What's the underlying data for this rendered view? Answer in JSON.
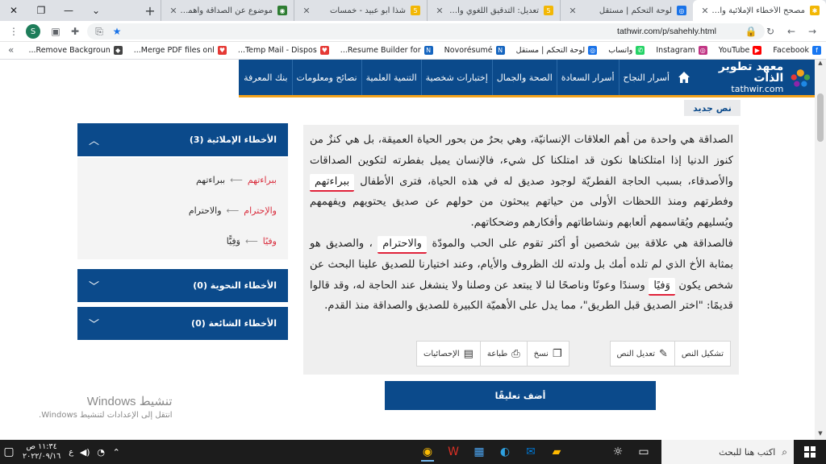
{
  "browser": {
    "tabs": [
      {
        "title": "مصحح الأخطاء الإملائية والنحوية",
        "favicon_color": "#f2b705",
        "active": true
      },
      {
        "title": "لوحة التحكم | مستقل",
        "favicon_color": "#1a73e8",
        "active": false
      },
      {
        "title": "تعديل: التدقيق اللغوي والإملائي",
        "favicon_color": "#f2b705",
        "active": false
      },
      {
        "title": "شذا أبو عبيد - خمسات",
        "favicon_color": "#f2b705",
        "active": false
      },
      {
        "title": "موضوع عن الصداقة وأهميتها",
        "favicon_color": "#2e7d32",
        "active": false
      }
    ],
    "url": "tathwir.com/p/sahehly.html",
    "profile_initial": "S",
    "bookmarks": [
      {
        "label": "Facebook",
        "icon": "facebook-icon",
        "color": "#1877f2"
      },
      {
        "label": "YouTube",
        "icon": "youtube-icon",
        "color": "#ff0000"
      },
      {
        "label": "Instagram",
        "icon": "instagram-icon",
        "color": "#c13584"
      },
      {
        "label": "واتساب",
        "icon": "whatsapp-icon",
        "color": "#25d366"
      },
      {
        "label": "لوحة التحكم | مستقل",
        "icon": "mostaql-icon",
        "color": "#1a73e8"
      },
      {
        "label": "Novorésumé",
        "icon": "novoresume-icon",
        "color": "#1565c0"
      },
      {
        "label": "Resume Builder for...",
        "icon": "resume-icon",
        "color": "#1565c0"
      },
      {
        "label": "Temp Mail - Dispos...",
        "icon": "tempmail-icon",
        "color": "#e53935"
      },
      {
        "label": "Merge PDF files onl...",
        "icon": "pdf-icon",
        "color": "#e53935"
      },
      {
        "label": "Remove Backgroun...",
        "icon": "removebg-icon",
        "color": "#444444"
      }
    ]
  },
  "site": {
    "logo_title": "معهد تطوير الذات",
    "logo_url": "tathwir.com",
    "nav": [
      "أسرار النجاح",
      "أسرار السعادة",
      "الصحة والجمال",
      "إختبارات شخصية",
      "التنمية العلمية",
      "نصائح ومعلومات",
      "بنك المعرفة"
    ]
  },
  "editor": {
    "label": "نص جديد",
    "p1_a": "الصداقة هي واحدة من أهم العلاقات الإنسانيّة، وهي بحرٌ من بحور الحياة العميقة، بل هي كنزٌ من كنوز الدنيا إذا امتلكناها نكون قد امتلكنا كل شيء، فالإنسان يميل بفطرته لتكوين الصداقات والأصدقاء، بسبب الحاجة الفطريّة لوجود صديق له في هذه الحياة، فترى الأطفال",
    "err1": "ببراءتهم",
    "p1_b": "وفطرتهم ومنذ اللحظات الأولى من حياتهم يبحثون من حولهم عن صديق يحتويهم ويفهمهم ويُسليهم ويُقاسمهم ألعابهم ونشاطاتهم وأفكارهم وضحكاتهم.",
    "p2_a": "فالصداقة هي علاقة بين شخصين أو أكثر تقوم على الحب والمودّة",
    "err2": "والاحترام",
    "p2_b": "، والصديق هو بمثابة الأخ الذي لم تلده أمك بل ولدته لك الظروف والأيام، وعند اختيارنا للصديق علينا البحث عن شخص يكون",
    "err3": "وَفيًا",
    "p2_c": "وسندًا وعونًا وناصحًا لنا لا يبتعد عن وصلنا ولا ينشغل عند الحاجة له، وقد قالوا قديمًا: \"اختر الصديق قبل الطريق\"، مما يدل على الأهميّة الكبيرة للصديق والصداقة منذ القدم.",
    "actions": {
      "tashkeel": "تشكيل النص",
      "edit": "تعديل النص",
      "copy": "نسخ",
      "print": "طباعة",
      "stats": "الإحصائيات"
    }
  },
  "sidebar": {
    "spelling_title": "الأخطاء الإملائية (3)",
    "corrections": [
      {
        "wrong": "ببراءتهم",
        "right": "ببراءتهم"
      },
      {
        "wrong": "والإحترام",
        "right": "والاحترام"
      },
      {
        "wrong": "وفيًا",
        "right": "وَفِيًّا"
      }
    ],
    "grammar_title": "الأخطاء النحوية (0)",
    "common_title": "الأخطاء الشائعة (0)"
  },
  "comment_button": "أضف تعليقًا",
  "windows_activation": {
    "title": "تنشيط Windows",
    "subtitle": "انتقل إلى الإعدادات لتنشيط Windows."
  },
  "taskbar": {
    "search_placeholder": "اكتب هنا للبحث",
    "time": "١١:٣٤ ص",
    "date": "٢٠٢٢/٠٩/١٦",
    "lang": "ع"
  }
}
